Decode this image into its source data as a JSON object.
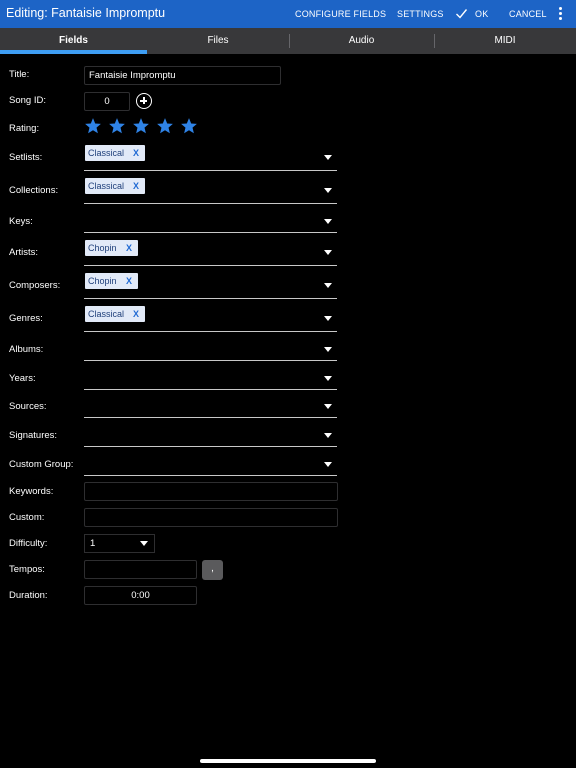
{
  "header": {
    "title": "Editing: Fantaisie Impromptu",
    "configure_fields": "CONFIGURE FIELDS",
    "settings": "SETTINGS",
    "ok": "OK",
    "cancel": "CANCEL"
  },
  "tabs": [
    {
      "label": "Fields",
      "active": true
    },
    {
      "label": "Files",
      "active": false
    },
    {
      "label": "Audio",
      "active": false
    },
    {
      "label": "MIDI",
      "active": false
    }
  ],
  "form": {
    "title": {
      "label": "Title:",
      "value": "Fantaisie Impromptu"
    },
    "song_id": {
      "label": "Song ID:",
      "value": "0"
    },
    "rating": {
      "label": "Rating:",
      "stars": 5,
      "max": 5,
      "star_color": "#2f83e6"
    },
    "setlists": {
      "label": "Setlists:",
      "chips": [
        "Classical"
      ]
    },
    "collections": {
      "label": "Collections:",
      "chips": [
        "Classical"
      ]
    },
    "keys": {
      "label": "Keys:",
      "chips": []
    },
    "artists": {
      "label": "Artists:",
      "chips": [
        "Chopin"
      ]
    },
    "composers": {
      "label": "Composers:",
      "chips": [
        "Chopin"
      ]
    },
    "genres": {
      "label": "Genres:",
      "chips": [
        "Classical"
      ]
    },
    "albums": {
      "label": "Albums:",
      "chips": []
    },
    "years": {
      "label": "Years:",
      "chips": []
    },
    "sources": {
      "label": "Sources:",
      "chips": []
    },
    "signatures": {
      "label": "Signatures:",
      "chips": []
    },
    "custom_group": {
      "label": "Custom Group:",
      "chips": []
    },
    "keywords": {
      "label": "Keywords:",
      "value": ""
    },
    "custom": {
      "label": "Custom:",
      "value": ""
    },
    "difficulty": {
      "label": "Difficulty:",
      "value": "1"
    },
    "tempos": {
      "label": "Tempos:",
      "value": "",
      "comma_button": ","
    },
    "duration": {
      "label": "Duration:",
      "value": "0:00"
    }
  },
  "chip_remove_glyph": "X",
  "colors": {
    "header_bg": "#1d64c6",
    "tab_bar_bg": "#38383a",
    "tab_indicator": "#3e9ef4",
    "chip_bg": "#e2eaf8",
    "chip_remove": "#1f69d3"
  }
}
